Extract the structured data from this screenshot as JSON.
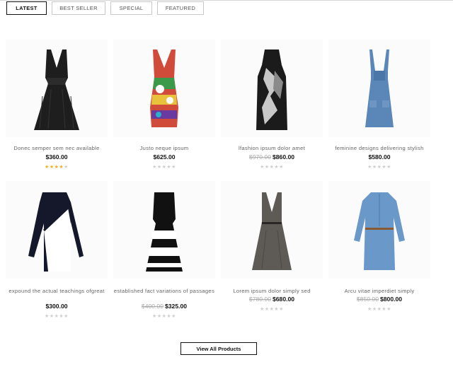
{
  "tabs": [
    {
      "label": "LATEST",
      "active": true
    },
    {
      "label": "BEST SELLER",
      "active": false
    },
    {
      "label": "SPECIAL",
      "active": false
    },
    {
      "label": "FEATURED",
      "active": false
    }
  ],
  "products": [
    {
      "name": "Donec semper sem nec available",
      "old_price": "",
      "price": "$360.00",
      "rating": 4,
      "image": "black-vneck-dress"
    },
    {
      "name": "Justo neque ipsum",
      "old_price": "",
      "price": "$625.00",
      "rating": 0,
      "image": "multicolor-pinafore-dress"
    },
    {
      "name": "lfashion ipsum dolor amet",
      "old_price": "$970.00",
      "price": "$860.00",
      "rating": 0,
      "image": "printed-halter-dress"
    },
    {
      "name": "feminine designs delivering stylish",
      "old_price": "",
      "price": "$580.00",
      "rating": 0,
      "image": "denim-dungaree-dress"
    },
    {
      "name": "expound the actual teachings ofgreat",
      "old_price": "",
      "price": "$300.00",
      "rating": 0,
      "image": "black-white-blazer-dress"
    },
    {
      "name": "established fact variations of passages",
      "old_price": "$400.00",
      "price": "$325.00",
      "rating": 0,
      "image": "striped-skater-dress"
    },
    {
      "name": "Lorem ipsum dolor simply sed",
      "old_price": "$780.00",
      "price": "$680.00",
      "rating": 0,
      "image": "grey-pinafore-dress"
    },
    {
      "name": "Arcu vitae imperdiet simply",
      "old_price": "$850.00",
      "price": "$800.00",
      "rating": 0,
      "image": "denim-shirt-dress"
    }
  ],
  "view_all_label": "View All Products"
}
